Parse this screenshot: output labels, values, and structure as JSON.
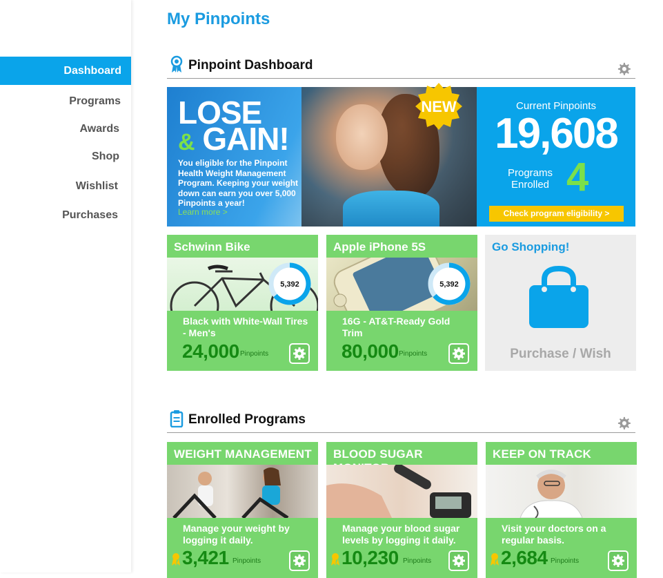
{
  "page": {
    "title": "My Pinpoints"
  },
  "sidebar": {
    "active": "Dashboard",
    "items": [
      "Programs",
      "Awards",
      "Shop",
      "Wishlist",
      "Purchases"
    ]
  },
  "dashboard": {
    "heading": "Pinpoint Dashboard",
    "hero": {
      "line1": "LOSE",
      "amp": "&",
      "line2": "GAIN!",
      "body": "You eligible for the Pinpoint Health Weight Management Program. Keeping your weight down can earn you over 5,000 Pinpoints a year!",
      "link": "Learn more >",
      "badge": "NEW"
    },
    "points": {
      "label": "Current Pinpoints",
      "value": "19,608",
      "enrolled_label_1": "Programs",
      "enrolled_label_2": "Enrolled",
      "enrolled_value": "4",
      "button": "Check program eligibility >"
    },
    "rewards": [
      {
        "title": "Schwinn Bike",
        "ring_value": "5,392",
        "desc": "Black with White-Wall Tires - Men's",
        "price": "24,000",
        "unit": "Pinpoints"
      },
      {
        "title": "Apple iPhone 5S",
        "ring_value": "5,392",
        "desc": "16G - AT&T-Ready Gold Trim",
        "price": "80,000",
        "unit": "Pinpoints"
      }
    ],
    "shop": {
      "title": "Go Shopping!",
      "footer": "Purchase / Wish"
    }
  },
  "enrolled": {
    "heading": "Enrolled Programs",
    "programs": [
      {
        "title": "WEIGHT MANAGEMENT",
        "desc": "Manage your weight by logging it daily.",
        "points": "3,421",
        "unit": "Pinpoints"
      },
      {
        "title": "BLOOD SUGAR MONITOR",
        "desc": "Manage your blood sugar levels by logging it daily.",
        "points": "10,230",
        "unit": "Pinpoints"
      },
      {
        "title": "KEEP ON TRACK",
        "desc": "Visit your doctors on a regular basis.",
        "points": "2,684",
        "unit": "Pinpoints"
      }
    ]
  },
  "colors": {
    "accent": "#0aa4ea",
    "green": "#78d66e",
    "dark_green": "#158a13",
    "yellow": "#f7c600"
  },
  "icons": [
    "ribbon-icon",
    "gear-icon",
    "clipboard-icon",
    "shopping-bag-icon",
    "medal-icon"
  ]
}
